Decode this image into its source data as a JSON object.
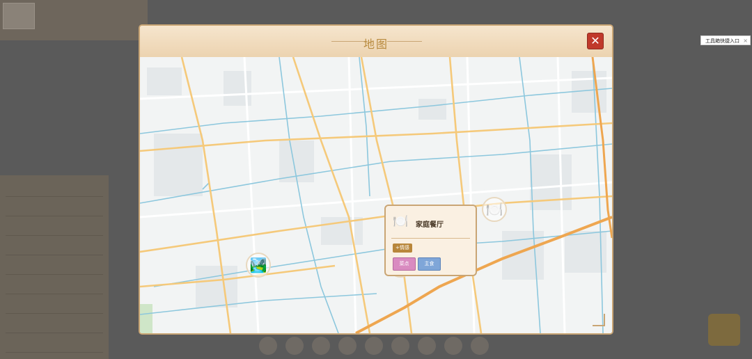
{
  "modal": {
    "title": "地图",
    "close_icon": "close-icon"
  },
  "popup": {
    "icon": "plate-utensils-icon",
    "name": "家庭餐厅",
    "tag": "+情感",
    "button_a": "菜点",
    "button_b": "主食"
  },
  "markers": [
    {
      "name": "landscape-painting-icon",
      "glyph": "🏞️"
    },
    {
      "name": "house-icon",
      "glyph": "🏠"
    },
    {
      "name": "plate-utensils-icon",
      "glyph": "🍽️"
    }
  ],
  "tooltip": {
    "text": "工具箱快捷入口",
    "close": "×"
  },
  "colors": {
    "frame": "#c9a574",
    "title": "#b88a3e",
    "close": "#c0392b",
    "road_major": "#f5c97a",
    "highway": "#eea650",
    "river": "#8cc7dd"
  }
}
